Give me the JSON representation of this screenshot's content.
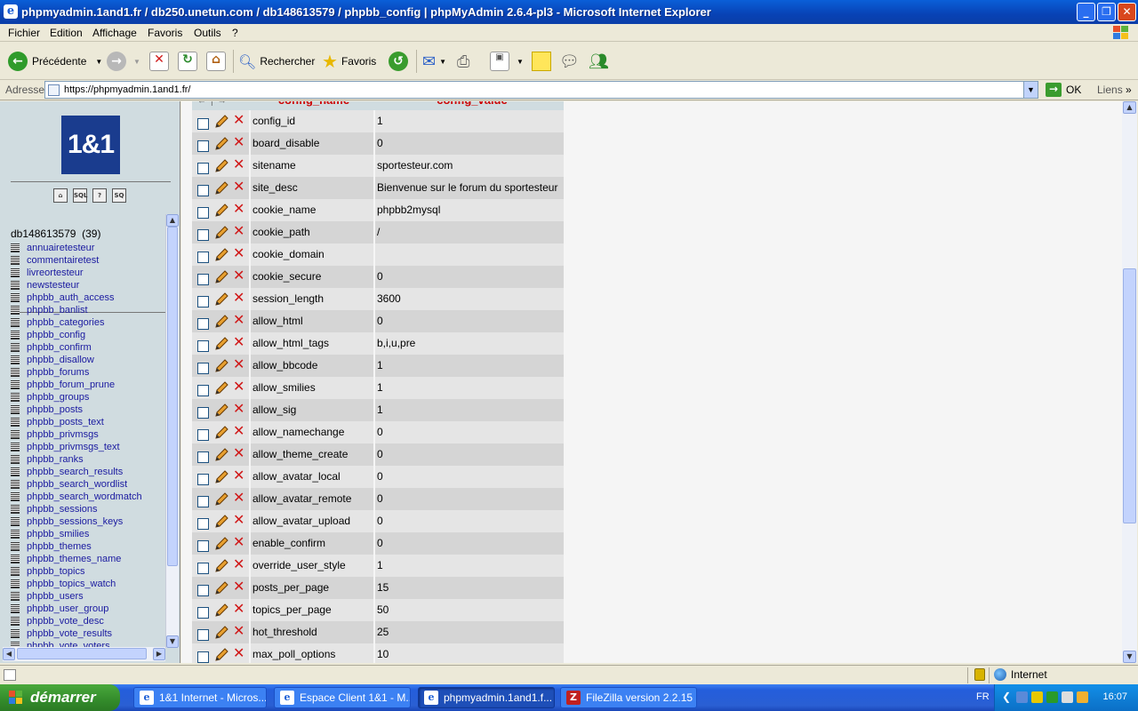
{
  "window": {
    "title": "phpmyadmin.1and1.fr / db250.unetun.com / db148613579 / phpbb_config | phpMyAdmin 2.6.4-pl3 - Microsoft Internet Explorer"
  },
  "menu": [
    "Fichier",
    "Edition",
    "Affichage",
    "Favoris",
    "Outils",
    "?"
  ],
  "toolbar": {
    "back_label": "Précédente",
    "search_label": "Rechercher",
    "favorites_label": "Favoris"
  },
  "address": {
    "label": "Adresse",
    "url": "https://phpmyadmin.1and1.fr/",
    "go_label": "OK",
    "links_label": "Liens"
  },
  "left": {
    "logo_text": "1&1",
    "db_name": "db148613579",
    "db_count": "(39)",
    "tables": [
      "annuairetesteur",
      "commentairetest",
      "livreortesteur",
      "newstesteur",
      "phpbb_auth_access",
      "phpbb_banlist",
      "phpbb_categories",
      "phpbb_config",
      "phpbb_confirm",
      "phpbb_disallow",
      "phpbb_forums",
      "phpbb_forum_prune",
      "phpbb_groups",
      "phpbb_posts",
      "phpbb_posts_text",
      "phpbb_privmsgs",
      "phpbb_privmsgs_text",
      "phpbb_ranks",
      "phpbb_search_results",
      "phpbb_search_wordlist",
      "phpbb_search_wordmatch",
      "phpbb_sessions",
      "phpbb_sessions_keys",
      "phpbb_smilies",
      "phpbb_themes",
      "phpbb_themes_name",
      "phpbb_topics",
      "phpbb_topics_watch",
      "phpbb_users",
      "phpbb_user_group",
      "phpbb_vote_desc",
      "phpbb_vote_results",
      "phpbb_vote_voters"
    ]
  },
  "table": {
    "headers": [
      "config_name",
      "config_value"
    ],
    "rows": [
      [
        "config_id",
        "1"
      ],
      [
        "board_disable",
        "0"
      ],
      [
        "sitename",
        "sportesteur.com"
      ],
      [
        "site_desc",
        "Bienvenue sur le forum du sportesteur"
      ],
      [
        "cookie_name",
        "phpbb2mysql"
      ],
      [
        "cookie_path",
        "/"
      ],
      [
        "cookie_domain",
        ""
      ],
      [
        "cookie_secure",
        "0"
      ],
      [
        "session_length",
        "3600"
      ],
      [
        "allow_html",
        "0"
      ],
      [
        "allow_html_tags",
        "b,i,u,pre"
      ],
      [
        "allow_bbcode",
        "1"
      ],
      [
        "allow_smilies",
        "1"
      ],
      [
        "allow_sig",
        "1"
      ],
      [
        "allow_namechange",
        "0"
      ],
      [
        "allow_theme_create",
        "0"
      ],
      [
        "allow_avatar_local",
        "0"
      ],
      [
        "allow_avatar_remote",
        "0"
      ],
      [
        "allow_avatar_upload",
        "0"
      ],
      [
        "enable_confirm",
        "0"
      ],
      [
        "override_user_style",
        "1"
      ],
      [
        "posts_per_page",
        "15"
      ],
      [
        "topics_per_page",
        "50"
      ],
      [
        "hot_threshold",
        "25"
      ],
      [
        "max_poll_options",
        "10"
      ]
    ]
  },
  "status": {
    "zone": "Internet"
  },
  "taskbar": {
    "start_label": "démarrer",
    "tasks": [
      "1&1 Internet - Micros...",
      "Espace Client 1&1 - M...",
      "phpmyadmin.1and1.f...",
      "FileZilla version 2.2.15"
    ],
    "lang": "FR",
    "clock": "16:07"
  },
  "colors": {
    "header_text": "#cc0000",
    "row_odd": "#e5e5e5",
    "row_even": "#d5d5d5",
    "left_bg": "#d0dce0",
    "link": "#1a1aa0"
  }
}
